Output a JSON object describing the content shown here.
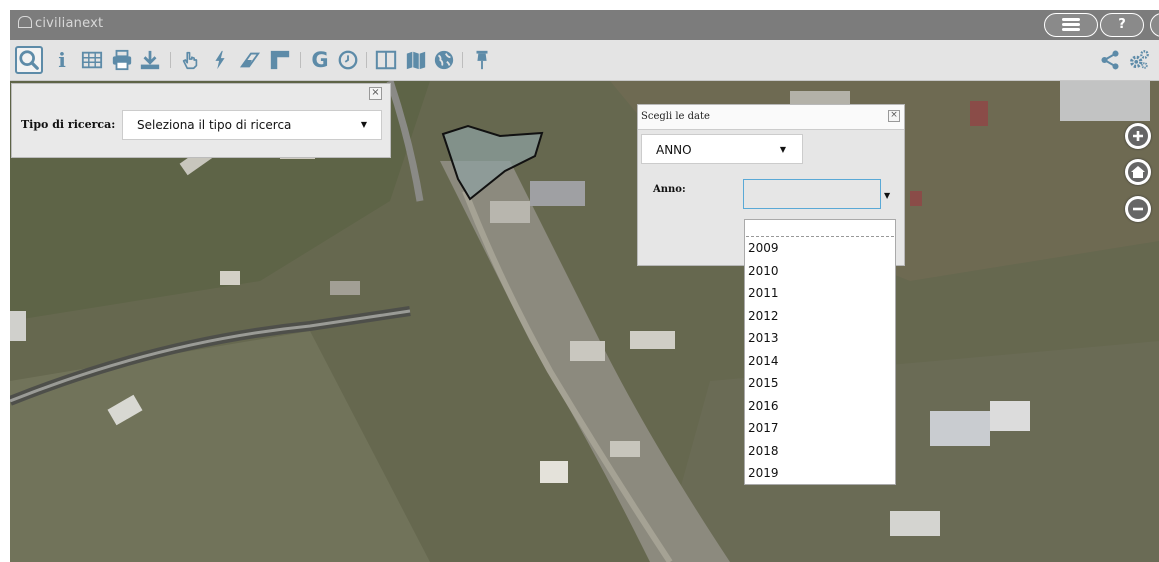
{
  "app": {
    "brand": "civilianext"
  },
  "topbar": {
    "help_label": "?"
  },
  "toolbar": {
    "tools_left": [
      "search-icon",
      "info-icon",
      "table-icon",
      "print-icon",
      "download-icon",
      "hand-pointer-icon",
      "lightning-icon",
      "eraser-icon",
      "ruler-icon",
      "g-icon",
      "clock-icon",
      "split-panel-icon",
      "map-icon",
      "globe-icon",
      "pin-icon"
    ],
    "tools_right": [
      "share-icon",
      "settings-icon"
    ],
    "info_glyph": "i",
    "g_glyph": "G"
  },
  "search_panel": {
    "label": "Tipo di ricerca:",
    "select_value": "Seleziona il tipo di ricerca",
    "close_glyph": "×"
  },
  "dates_panel": {
    "title": "Scegli le date",
    "close_glyph": "×",
    "mode_value": "ANNO",
    "year_label": "Anno:",
    "year_value": "",
    "year_options": [
      "2009",
      "2010",
      "2011",
      "2012",
      "2013",
      "2014",
      "2015",
      "2016",
      "2017",
      "2018",
      "2019"
    ]
  },
  "map_controls": [
    "zoom-in-icon",
    "home-icon",
    "zoom-out-icon"
  ],
  "colors": {
    "titlebar": "#7c7c7c",
    "toolbar": "#e4e4e4",
    "icon_blue": "#5d8ba8",
    "active_border": "#5d8ba8",
    "select_focus": "#5aa9d6"
  }
}
